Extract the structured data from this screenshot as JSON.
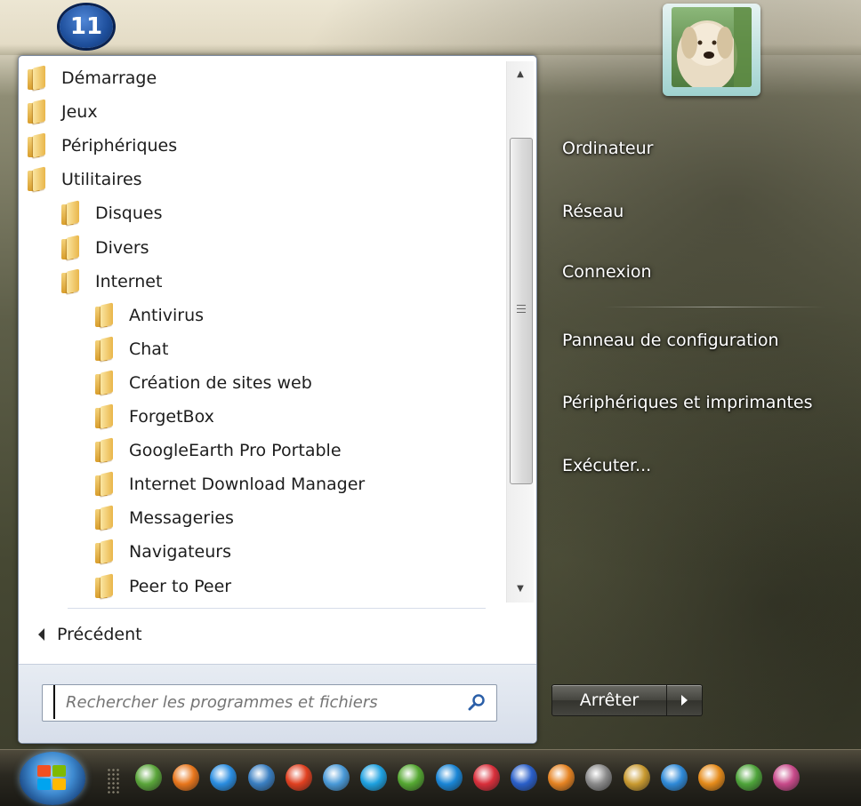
{
  "desktop": {
    "badge_number": "11"
  },
  "programs": {
    "items": [
      {
        "label": "Démarrage",
        "level": 0
      },
      {
        "label": "Jeux",
        "level": 0
      },
      {
        "label": "Périphériques",
        "level": 0
      },
      {
        "label": "Utilitaires",
        "level": 0
      },
      {
        "label": "Disques",
        "level": 1
      },
      {
        "label": "Divers",
        "level": 1
      },
      {
        "label": "Internet",
        "level": 1
      },
      {
        "label": "Antivirus",
        "level": 2
      },
      {
        "label": "Chat",
        "level": 2
      },
      {
        "label": "Création de sites web",
        "level": 2
      },
      {
        "label": "ForgetBox",
        "level": 2
      },
      {
        "label": "GoogleEarth Pro Portable",
        "level": 2
      },
      {
        "label": "Internet Download Manager",
        "level": 2
      },
      {
        "label": "Messageries",
        "level": 2
      },
      {
        "label": "Navigateurs",
        "level": 2
      },
      {
        "label": "Peer to Peer",
        "level": 2
      }
    ],
    "back_label": "Précédent"
  },
  "search": {
    "placeholder": "Rechercher les programmes et fichiers"
  },
  "right_menu": {
    "items": [
      "Ordinateur",
      "Réseau",
      "Connexion",
      "Panneau de configuration",
      "Périphériques et imprimantes",
      "Exécuter..."
    ]
  },
  "shutdown": {
    "label": "Arrêter"
  },
  "taskbar": {
    "pinned_icons": [
      {
        "name": "plant-icon",
        "color": "#5aa53a"
      },
      {
        "name": "firefox-icon",
        "color": "#e8761c"
      },
      {
        "name": "internet-explorer-icon",
        "color": "#2a8de0"
      },
      {
        "name": "printer-icon",
        "color": "#3a7fc2"
      },
      {
        "name": "mail-icon",
        "color": "#e04020"
      },
      {
        "name": "landscape-icon",
        "color": "#4a9ad8"
      },
      {
        "name": "skype-icon",
        "color": "#1ea1e0"
      },
      {
        "name": "flame-icon",
        "color": "#55a832"
      },
      {
        "name": "cube-icon",
        "color": "#1a86d6"
      },
      {
        "name": "shield-icon",
        "color": "#d92f3b"
      },
      {
        "name": "feather-icon",
        "color": "#2a5fc9"
      },
      {
        "name": "brush-icon",
        "color": "#e58322"
      },
      {
        "name": "tm-icon",
        "color": "#8a8a8a"
      },
      {
        "name": "tools-icon",
        "color": "#c99a30"
      },
      {
        "name": "download-icon",
        "color": "#2f8ad8"
      },
      {
        "name": "palette-icon",
        "color": "#e58b1a"
      },
      {
        "name": "dreamweaver-icon",
        "color": "#4ea43a"
      },
      {
        "name": "network-icon",
        "color": "#c84a8a"
      }
    ]
  }
}
